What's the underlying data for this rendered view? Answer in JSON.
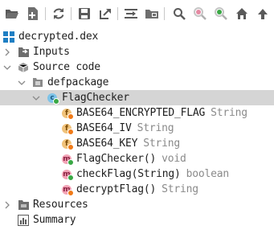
{
  "toolbar": {
    "buttons": [
      {
        "name": "open-folder-icon"
      },
      {
        "name": "add-file-icon"
      },
      {
        "name": "sync-icon"
      },
      {
        "name": "save-icon"
      },
      {
        "name": "export-icon"
      },
      {
        "name": "sync-editor-icon"
      },
      {
        "name": "flatten-packages-icon"
      },
      {
        "name": "search-icon"
      },
      {
        "name": "search-class-icon"
      },
      {
        "name": "search-usage-icon"
      },
      {
        "name": "home-icon"
      },
      {
        "name": "arrow-up-icon"
      }
    ]
  },
  "tree": {
    "root": "decrypted.dex",
    "inputs": "Inputs",
    "source_code": "Source code",
    "package": "defpackage",
    "class_name": "FlagChecker",
    "members": [
      {
        "name": "BASE64_ENCRYPTED_FLAG",
        "type": "String",
        "kind": "field"
      },
      {
        "name": "BASE64_IV",
        "type": "String",
        "kind": "field"
      },
      {
        "name": "BASE64_KEY",
        "type": "String",
        "kind": "field"
      },
      {
        "name": "FlagChecker()",
        "type": "void",
        "kind": "method"
      },
      {
        "name": "checkFlag(String)",
        "type": "boolean",
        "kind": "method"
      },
      {
        "name": "decryptFlag()",
        "type": "String",
        "kind": "method"
      }
    ],
    "resources": "Resources",
    "summary": "Summary"
  },
  "colors": {
    "selection": "#d5d5d5",
    "type_text": "#8a8a8a",
    "field_icon": "#f0c27a",
    "method_icon": "#f3a3b6",
    "class_icon": "#7ec3e8",
    "visibility_dot_green": "#3aa845",
    "visibility_dot_orange": "#f07a18"
  }
}
